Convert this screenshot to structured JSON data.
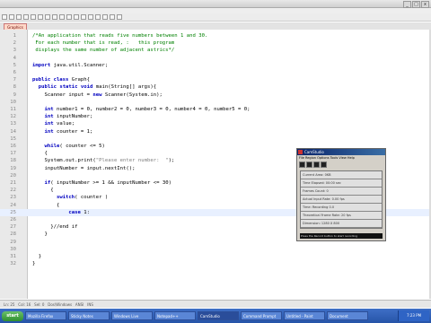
{
  "window": {
    "title_buttons": [
      "_",
      "□",
      "x"
    ]
  },
  "editor": {
    "tab_label": "Graphics",
    "lines": [
      {
        "n": "1",
        "html": "<span class=\"cm\">/*An application that reads five numbers between 1 and 30.</span>"
      },
      {
        "n": "2",
        "html": "<span class=\"cm\"> For each number that is read, :   this program</span>"
      },
      {
        "n": "3",
        "html": "<span class=\"cm\"> displays the same number of adjacent astrics*/</span>"
      },
      {
        "n": "4",
        "html": ""
      },
      {
        "n": "5",
        "html": "<span class=\"kw\">import</span> java.util.Scanner;"
      },
      {
        "n": "6",
        "html": ""
      },
      {
        "n": "7",
        "html": "<span class=\"kw\">public class</span> Graph{"
      },
      {
        "n": "8",
        "html": "  <span class=\"kw\">public static void</span> main(String[] args){"
      },
      {
        "n": "9",
        "html": "    Scanner input = <span class=\"kw\">new</span> Scanner(System.in);"
      },
      {
        "n": "10",
        "html": ""
      },
      {
        "n": "11",
        "html": "    <span class=\"kw\">int</span> number1 = 0, number2 = 0, number3 = 0, number4 = 0, number5 = 0;"
      },
      {
        "n": "12",
        "html": "    <span class=\"kw\">int</span> inputNumber;"
      },
      {
        "n": "13",
        "html": "    <span class=\"kw\">int</span> value;"
      },
      {
        "n": "14",
        "html": "    <span class=\"kw\">int</span> counter = 1;"
      },
      {
        "n": "15",
        "html": ""
      },
      {
        "n": "16",
        "html": "    <span class=\"kw\">while</span>( counter &lt;= 5)"
      },
      {
        "n": "17",
        "html": "    {"
      },
      {
        "n": "18",
        "html": "    System.out.print(<span class=\"st\">\"Please enter number:  \"</span>);"
      },
      {
        "n": "19",
        "html": "    inputNumber = input.nextInt();"
      },
      {
        "n": "20",
        "html": ""
      },
      {
        "n": "21",
        "html": "    <span class=\"kw\">if</span>( inputNumber &gt;= 1 &amp;&amp; inputNumber &lt;= 30)"
      },
      {
        "n": "22",
        "html": "      {"
      },
      {
        "n": "23",
        "html": "        <span class=\"kw\">switch</span>( counter )"
      },
      {
        "n": "24",
        "html": "        {"
      },
      {
        "n": "25",
        "html": "            <span class=\"kw\">case</span> 1:",
        "highlight": true
      },
      {
        "n": "26",
        "html": ""
      },
      {
        "n": "27",
        "html": "      }//end if"
      },
      {
        "n": "28",
        "html": "    }"
      },
      {
        "n": "29",
        "html": ""
      },
      {
        "n": "30",
        "html": ""
      },
      {
        "n": "31",
        "html": "  }"
      },
      {
        "n": "32",
        "html": "}"
      }
    ]
  },
  "camstudio": {
    "title": "CamStudio",
    "menu": "File  Region  Options  Tools  View  Help",
    "rows": [
      "Current Area: 0KB",
      "Time Elapsed: 00:00 sec",
      "Frames Count: 0",
      "Actual Input Rate: 0.00 fps",
      "Time: Recording 0.0",
      "Theoretical Frame Rate: 20 fps",
      "Dimension: 1280 X 800"
    ],
    "footer": "Press the Record button to start recording"
  },
  "statusbar": {
    "text": "Ln: 25   Col: 16   Sel: 0   Dos\\Windows   ANSI   INS"
  },
  "taskbar": {
    "start_label": "start",
    "tasks": [
      {
        "label": "Mozilla Firefox"
      },
      {
        "label": "Sticky Notes"
      },
      {
        "label": "Windows Live"
      },
      {
        "label": "Notepad++"
      },
      {
        "label": "CamStudio",
        "active": true
      },
      {
        "label": "Command Prompt"
      },
      {
        "label": "Untitled - Paint"
      },
      {
        "label": "Document"
      }
    ],
    "clock": "7:23 PM"
  }
}
